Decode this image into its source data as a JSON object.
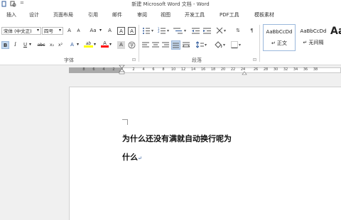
{
  "title_bar": {
    "title": "新建 Microsoft Word 文档 - Word",
    "quick_access_more": "="
  },
  "tabs": [
    "插入",
    "设计",
    "页面布局",
    "引用",
    "邮件",
    "审阅",
    "视图",
    "开发工具",
    "PDF工具",
    "模板素材"
  ],
  "font_group": {
    "font_name": "宋体 (中文正)",
    "font_size": "四号",
    "grow": "A",
    "shrink": "A",
    "change_case": "Aa",
    "clear_format": "A",
    "bold": "B",
    "italic": "I",
    "underline": "U",
    "strike": "abc",
    "subscript": "x₂",
    "superscript": "x²",
    "text_effect": "A",
    "highlight": "ab",
    "font_color": "A",
    "shade": "A",
    "enclose": "字",
    "label": "字体"
  },
  "paragraph_group": {
    "label": "段落",
    "sort": "⇅",
    "show_marks": "¶"
  },
  "styles": [
    {
      "preview": "AaBbCcDd",
      "name": "↵ 正文"
    },
    {
      "preview": "AaBbCcDd",
      "name": "↵ 无间隔"
    },
    {
      "preview": "Aa",
      "name": ""
    }
  ],
  "ruler": {
    "ticks": [
      "8",
      "6",
      "4",
      "2",
      "2",
      "4",
      "6",
      "8",
      "10",
      "12",
      "14",
      "16",
      "18",
      "20",
      "22",
      "24",
      "26",
      "28",
      "30",
      "32",
      "34",
      "36",
      "38"
    ]
  },
  "document": {
    "line1": "为什么还没有满就自动换行呢为",
    "line2": "什么",
    "para_mark": "↵"
  },
  "colors": {
    "accent": "#2b579a",
    "highlight_yellow": "#ffff00",
    "font_red": "#ff0000",
    "ribbon_bg": "#ffffff"
  }
}
